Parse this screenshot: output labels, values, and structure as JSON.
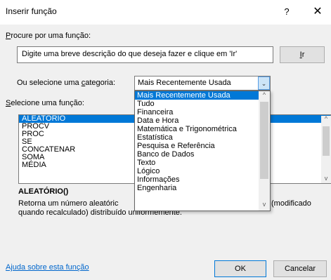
{
  "window": {
    "title": "Inserir função",
    "help": "?",
    "close": "✕"
  },
  "search": {
    "label_first": "P",
    "label_rest": "rocure por uma função:",
    "value": "Digite uma breve descrição do que deseja fazer e clique em 'Ir'",
    "go_button_first": "I",
    "go_button_rest": "r"
  },
  "category": {
    "label_pre": "Ou selecione uma ",
    "label_u": "c",
    "label_post": "ategoria:",
    "selected": "Mais Recentemente Usada"
  },
  "function_list": {
    "label_first": "S",
    "label_rest": "elecione uma função:",
    "items": [
      "ALEATÓRIO",
      "PROCV",
      "PROC",
      "SE",
      "CONCATENAR",
      "SOMA",
      "MÉDIA"
    ],
    "selected_index": 0
  },
  "description": {
    "title": "ALEATÓRIO()",
    "text_line1_visible": "Retorna um número aleatóric",
    "text_line1_end": "(modificado",
    "text_line2": "quando recalculado) distribuído uniformemente."
  },
  "dropdown": {
    "options": [
      "Mais Recentemente Usada",
      "Tudo",
      "Financeira",
      "Data e Hora",
      "Matemática e Trigonométrica",
      "Estatística",
      "Pesquisa e Referência",
      "Banco de Dados",
      "Texto",
      "Lógico",
      "Informações",
      "Engenharia"
    ],
    "selected_index": 0
  },
  "footer": {
    "help_link": "Ajuda sobre esta função",
    "ok": "OK",
    "cancel": "Cancelar"
  },
  "icons": {
    "chevron_down": "⌄",
    "scroll_up": "^",
    "scroll_down": "v"
  },
  "colors": {
    "selection": "#0078d7",
    "link": "#0066cc",
    "background": "#f0f0f0"
  }
}
